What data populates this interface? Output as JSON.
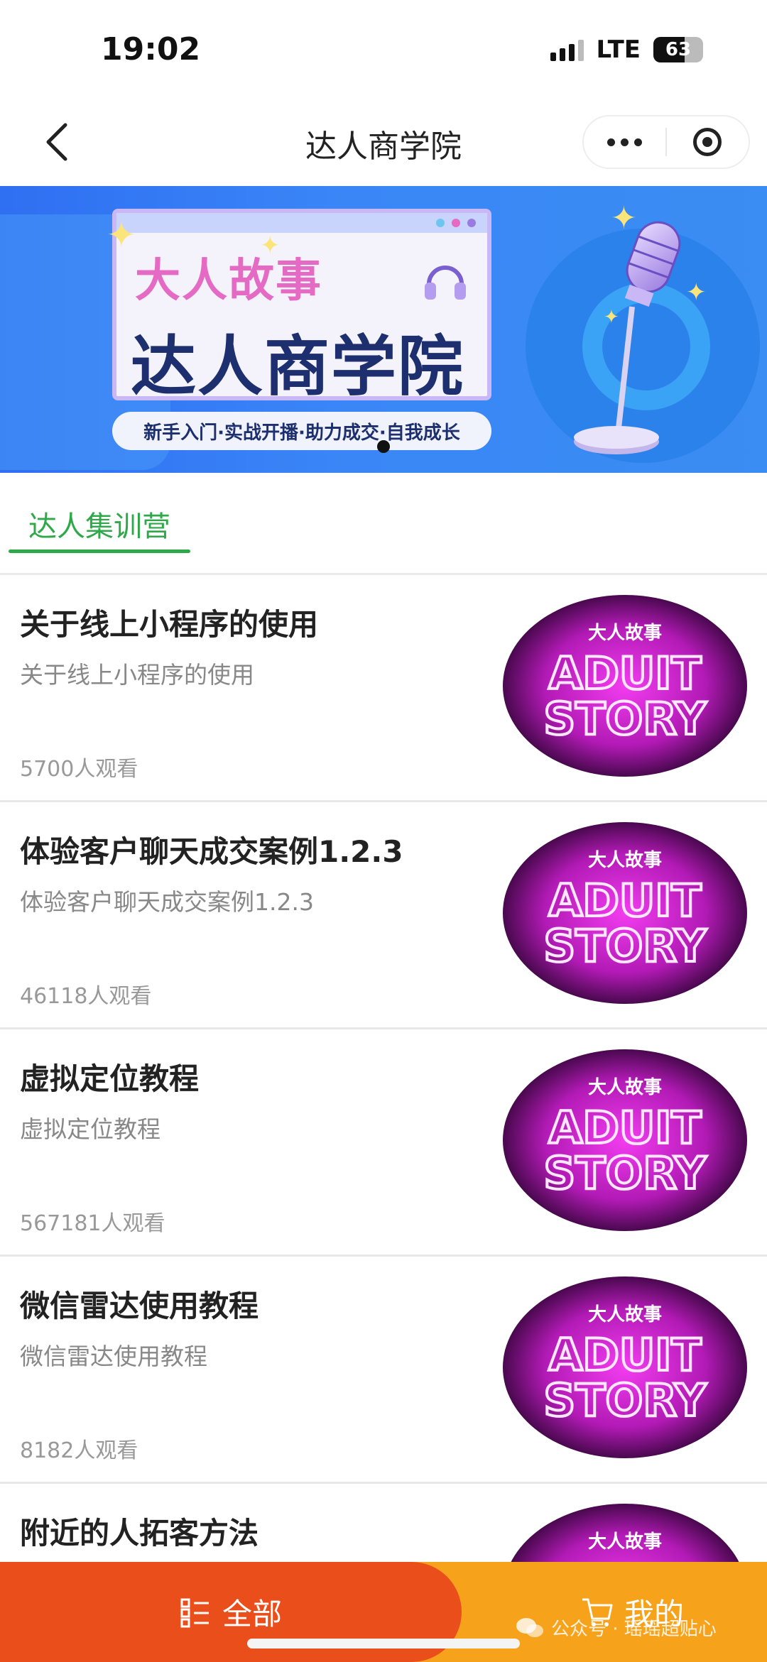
{
  "status_bar": {
    "time": "19:02",
    "network": "LTE",
    "battery": "63"
  },
  "nav": {
    "title": "达人商学院"
  },
  "banner": {
    "line1": "大人故事",
    "line2": "达人商学院",
    "tagline": "新手入门·实战开播·助力成交·自我成长"
  },
  "tabs": [
    {
      "label": "达人集训营",
      "active": true
    }
  ],
  "items": [
    {
      "title": "关于线上小程序的使用",
      "subtitle": "关于线上小程序的使用",
      "views": "5700人观看"
    },
    {
      "title": "体验客户聊天成交案例1.2.3",
      "subtitle": "体验客户聊天成交案例1.2.3",
      "views": "46118人观看"
    },
    {
      "title": "虚拟定位教程",
      "subtitle": "虚拟定位教程",
      "views": "567181人观看"
    },
    {
      "title": "微信雷达使用教程",
      "subtitle": "微信雷达使用教程",
      "views": "8182人观看"
    },
    {
      "title": "附近的人拓客方法",
      "subtitle": "",
      "views": ""
    }
  ],
  "thumbnail": {
    "top_text": "大人故事",
    "line1": "ADUIT",
    "line2": "STORY"
  },
  "bottom_bar": {
    "all_label": "全部",
    "mine_label": "我的"
  },
  "watermark": "公众号 · 瑶瑶超贴心",
  "colors": {
    "accent_green": "#2fa84a",
    "bottom_left": "#ea4e1b",
    "bottom_right": "#f7a21b"
  }
}
